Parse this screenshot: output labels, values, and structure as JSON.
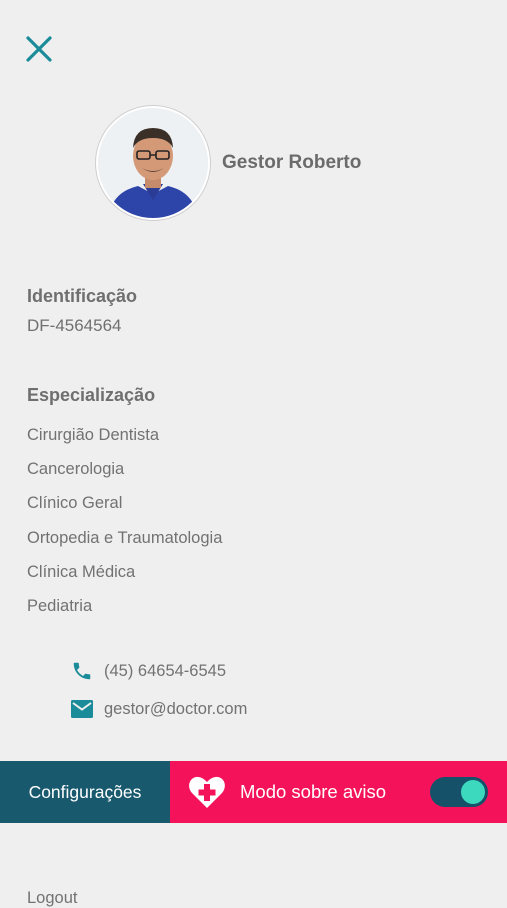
{
  "profile": {
    "name": "Gestor Roberto"
  },
  "identification": {
    "title": "Identificação",
    "value": "DF-4564564"
  },
  "specialization": {
    "title": "Especialização",
    "items": [
      "Cirurgião Dentista",
      "Cancerologia",
      "Clínico Geral",
      "Ortopedia e Traumatologia",
      "Clínica Médica",
      "Pediatria"
    ]
  },
  "contact": {
    "phone": "(45) 64654-6545",
    "email": "gestor@doctor.com",
    "icon_color": "#1a8b98"
  },
  "bottom_bar": {
    "settings_label": "Configurações",
    "oncall_label": "Modo sobre aviso",
    "oncall_enabled": true,
    "settings_color": "#18596e",
    "oncall_color": "#f4135a"
  },
  "logout_label": "Logout",
  "accent_color": "#1a8b98"
}
